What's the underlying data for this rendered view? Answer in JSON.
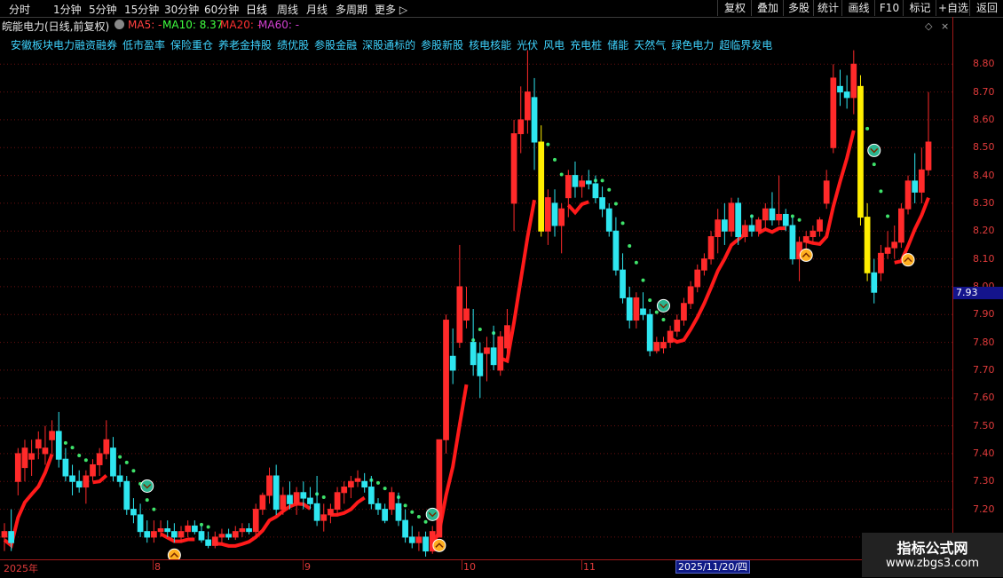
{
  "toolbar": {
    "periods": [
      "分时",
      "1分钟",
      "5分钟",
      "15分钟",
      "30分钟",
      "60分钟",
      "日线",
      "周线",
      "月线",
      "多周期",
      "更多 ▷"
    ],
    "right_buttons": [
      "复权",
      "叠加",
      "多股",
      "统计",
      "画线",
      "F10",
      "标记",
      "+自选",
      "返回"
    ]
  },
  "title": {
    "stock": "皖能电力(日线,前复权)",
    "ma5": "MA5: -",
    "ma10": "MA10: 8.37",
    "ma20": "MA20: -",
    "ma60": "MA60: -",
    "colors": {
      "ma5": "#ff4040",
      "ma10": "#40ff40",
      "ma20": "#ff3030",
      "ma60": "#d040d0"
    }
  },
  "tags": [
    "安徽板块电力融资融券",
    "低市盈率",
    "保险重仓",
    "养老金持股",
    "绩优股",
    "参股金融",
    "深股通标的",
    "参股新股",
    "核电核能",
    "光伏",
    "风电",
    "充电桩",
    "储能",
    "天然气",
    "绿色电力",
    "超临界发电"
  ],
  "y_axis": {
    "labels": [
      "8.80",
      "8.70",
      "8.60",
      "8.50",
      "8.40",
      "8.30",
      "8.20",
      "8.10",
      "8.00",
      "7.90",
      "7.80",
      "7.70",
      "7.60",
      "7.50",
      "7.40",
      "7.30",
      "7.20",
      "7.10"
    ],
    "current_price": "7.93"
  },
  "x_axis": {
    "labels": [
      "2025年",
      "8",
      "9",
      "10",
      "11"
    ],
    "cursor_date": "2025/11/20/四"
  },
  "watermark": {
    "line1": "指标公式网",
    "line2": "www.zbgs3.com"
  },
  "chart_data": {
    "type": "candlestick",
    "ylim": [
      7.02,
      8.97
    ],
    "candles": [
      [
        7.1,
        7.15,
        7.05,
        7.12
      ],
      [
        7.12,
        7.2,
        7.05,
        7.08
      ],
      [
        7.3,
        7.42,
        7.25,
        7.4
      ],
      [
        7.35,
        7.45,
        7.3,
        7.42
      ],
      [
        7.38,
        7.45,
        7.32,
        7.4
      ],
      [
        7.42,
        7.48,
        7.38,
        7.45
      ],
      [
        7.4,
        7.5,
        7.36,
        7.42
      ],
      [
        7.45,
        7.52,
        7.4,
        7.48
      ],
      [
        7.48,
        7.55,
        7.35,
        7.38
      ],
      [
        7.38,
        7.42,
        7.3,
        7.32
      ],
      [
        7.32,
        7.36,
        7.25,
        7.3
      ],
      [
        7.3,
        7.34,
        7.26,
        7.28
      ],
      [
        7.28,
        7.34,
        7.22,
        7.32
      ],
      [
        7.32,
        7.38,
        7.3,
        7.36
      ],
      [
        7.36,
        7.42,
        7.32,
        7.4
      ],
      [
        7.4,
        7.52,
        7.38,
        7.45
      ],
      [
        7.42,
        7.46,
        7.3,
        7.32
      ],
      [
        7.32,
        7.36,
        7.28,
        7.3
      ],
      [
        7.3,
        7.32,
        7.18,
        7.2
      ],
      [
        7.2,
        7.24,
        7.15,
        7.18
      ],
      [
        7.18,
        7.22,
        7.1,
        7.12
      ],
      [
        7.12,
        7.16,
        7.08,
        7.1
      ],
      [
        7.1,
        7.16,
        7.08,
        7.12
      ],
      [
        7.12,
        7.16,
        7.1,
        7.13
      ],
      [
        7.13,
        7.16,
        7.1,
        7.12
      ],
      [
        7.12,
        7.15,
        7.08,
        7.1
      ],
      [
        7.1,
        7.14,
        7.08,
        7.12
      ],
      [
        7.12,
        7.16,
        7.1,
        7.14
      ],
      [
        7.14,
        7.16,
        7.11,
        7.12
      ],
      [
        7.12,
        7.14,
        7.08,
        7.09
      ],
      [
        7.09,
        7.12,
        7.06,
        7.07
      ],
      [
        7.07,
        7.12,
        7.06,
        7.1
      ],
      [
        7.1,
        7.13,
        7.08,
        7.11
      ],
      [
        7.11,
        7.13,
        7.09,
        7.1
      ],
      [
        7.1,
        7.14,
        7.09,
        7.12
      ],
      [
        7.12,
        7.15,
        7.1,
        7.13
      ],
      [
        7.13,
        7.15,
        7.11,
        7.12
      ],
      [
        7.12,
        7.22,
        7.1,
        7.2
      ],
      [
        7.2,
        7.26,
        7.18,
        7.25
      ],
      [
        7.25,
        7.35,
        7.22,
        7.32
      ],
      [
        7.32,
        7.36,
        7.18,
        7.2
      ],
      [
        7.2,
        7.28,
        7.18,
        7.25
      ],
      [
        7.25,
        7.3,
        7.2,
        7.22
      ],
      [
        7.22,
        7.28,
        7.18,
        7.26
      ],
      [
        7.26,
        7.3,
        7.2,
        7.24
      ],
      [
        7.24,
        7.28,
        7.2,
        7.22
      ],
      [
        7.22,
        7.32,
        7.14,
        7.16
      ],
      [
        7.16,
        7.22,
        7.12,
        7.18
      ],
      [
        7.18,
        7.22,
        7.15,
        7.2
      ],
      [
        7.2,
        7.28,
        7.18,
        7.26
      ],
      [
        7.26,
        7.3,
        7.22,
        7.28
      ],
      [
        7.28,
        7.32,
        7.24,
        7.3
      ],
      [
        7.3,
        7.34,
        7.28,
        7.31
      ],
      [
        7.3,
        7.33,
        7.26,
        7.28
      ],
      [
        7.28,
        7.32,
        7.2,
        7.22
      ],
      [
        7.22,
        7.24,
        7.18,
        7.2
      ],
      [
        7.2,
        7.22,
        7.15,
        7.16
      ],
      [
        7.2,
        7.28,
        7.18,
        7.26
      ],
      [
        7.22,
        7.26,
        7.14,
        7.16
      ],
      [
        7.16,
        7.2,
        7.08,
        7.1
      ],
      [
        7.1,
        7.14,
        7.06,
        7.08
      ],
      [
        7.08,
        7.12,
        7.05,
        7.1
      ],
      [
        7.1,
        7.12,
        7.03,
        7.05
      ],
      [
        7.05,
        7.14,
        7.04,
        7.12
      ],
      [
        7.1,
        7.45,
        7.1,
        7.45
      ],
      [
        7.45,
        7.9,
        7.4,
        7.88
      ],
      [
        7.75,
        7.85,
        7.65,
        7.7
      ],
      [
        7.8,
        8.15,
        7.78,
        8.0
      ],
      [
        7.88,
        8.0,
        7.85,
        7.92
      ],
      [
        7.8,
        7.92,
        7.68,
        7.72
      ],
      [
        7.76,
        7.8,
        7.6,
        7.68
      ],
      [
        7.76,
        7.82,
        7.66,
        7.78
      ],
      [
        7.78,
        7.86,
        7.7,
        7.72
      ],
      [
        7.7,
        7.84,
        7.68,
        7.82
      ],
      [
        7.78,
        7.92,
        7.76,
        7.86
      ],
      [
        8.3,
        8.6,
        8.2,
        8.55
      ],
      [
        8.55,
        8.72,
        8.48,
        8.6
      ],
      [
        8.6,
        8.85,
        8.55,
        8.7
      ],
      [
        8.68,
        8.75,
        8.42,
        8.52
      ],
      [
        8.52,
        8.58,
        8.18,
        8.2
      ],
      [
        8.2,
        8.35,
        8.15,
        8.32
      ],
      [
        8.3,
        8.35,
        8.18,
        8.22
      ],
      [
        8.22,
        8.3,
        8.12,
        8.28
      ],
      [
        8.32,
        8.42,
        8.25,
        8.4
      ],
      [
        8.4,
        8.45,
        8.32,
        8.36
      ],
      [
        8.36,
        8.4,
        8.32,
        8.38
      ],
      [
        8.38,
        8.42,
        8.35,
        8.37
      ],
      [
        8.37,
        8.4,
        8.3,
        8.32
      ],
      [
        8.32,
        8.36,
        8.25,
        8.28
      ],
      [
        8.28,
        8.3,
        8.18,
        8.2
      ],
      [
        8.2,
        8.25,
        8.04,
        8.06
      ],
      [
        8.06,
        8.12,
        7.94,
        7.96
      ],
      [
        7.96,
        8.0,
        7.85,
        7.88
      ],
      [
        7.88,
        7.98,
        7.85,
        7.96
      ],
      [
        7.92,
        7.98,
        7.88,
        7.9
      ],
      [
        7.9,
        7.92,
        7.75,
        7.77
      ],
      [
        7.77,
        7.82,
        7.76,
        7.8
      ],
      [
        7.78,
        7.82,
        7.76,
        7.8
      ],
      [
        7.8,
        7.86,
        7.78,
        7.84
      ],
      [
        7.84,
        7.9,
        7.82,
        7.88
      ],
      [
        7.88,
        7.96,
        7.86,
        7.94
      ],
      [
        7.94,
        8.02,
        7.92,
        8.0
      ],
      [
        8.0,
        8.08,
        7.98,
        8.06
      ],
      [
        8.06,
        8.12,
        8.04,
        8.1
      ],
      [
        8.1,
        8.2,
        8.08,
        8.18
      ],
      [
        8.18,
        8.28,
        8.12,
        8.24
      ],
      [
        8.24,
        8.3,
        8.15,
        8.2
      ],
      [
        8.2,
        8.32,
        8.18,
        8.3
      ],
      [
        8.3,
        8.32,
        8.15,
        8.18
      ],
      [
        8.18,
        8.24,
        8.16,
        8.22
      ],
      [
        8.22,
        8.26,
        8.18,
        8.2
      ],
      [
        8.2,
        8.25,
        8.18,
        8.24
      ],
      [
        8.24,
        8.3,
        8.2,
        8.28
      ],
      [
        8.28,
        8.34,
        8.22,
        8.24
      ],
      [
        8.24,
        8.4,
        8.22,
        8.26
      ],
      [
        8.26,
        8.28,
        8.2,
        8.22
      ],
      [
        8.22,
        8.25,
        8.08,
        8.1
      ],
      [
        8.1,
        8.18,
        8.02,
        8.16
      ],
      [
        8.16,
        8.2,
        8.12,
        8.18
      ],
      [
        8.18,
        8.22,
        8.16,
        8.2
      ],
      [
        8.2,
        8.25,
        8.18,
        8.24
      ],
      [
        8.3,
        8.42,
        8.28,
        8.38
      ],
      [
        8.5,
        8.8,
        8.48,
        8.75
      ],
      [
        8.72,
        8.78,
        8.65,
        8.7
      ],
      [
        8.7,
        8.76,
        8.64,
        8.68
      ],
      [
        8.68,
        8.85,
        8.62,
        8.8
      ],
      [
        8.72,
        8.76,
        8.22,
        8.25
      ],
      [
        8.25,
        8.3,
        8.02,
        8.05
      ],
      [
        8.05,
        8.1,
        7.94,
        7.98
      ],
      [
        8.05,
        8.15,
        8.02,
        8.12
      ],
      [
        8.12,
        8.2,
        8.1,
        8.14
      ],
      [
        8.14,
        8.22,
        8.1,
        8.16
      ],
      [
        8.16,
        8.3,
        8.14,
        8.28
      ],
      [
        8.28,
        8.4,
        8.26,
        8.38
      ],
      [
        8.38,
        8.48,
        8.3,
        8.34
      ],
      [
        8.34,
        8.5,
        8.3,
        8.42
      ],
      [
        8.42,
        8.7,
        8.4,
        8.52
      ]
    ]
  }
}
